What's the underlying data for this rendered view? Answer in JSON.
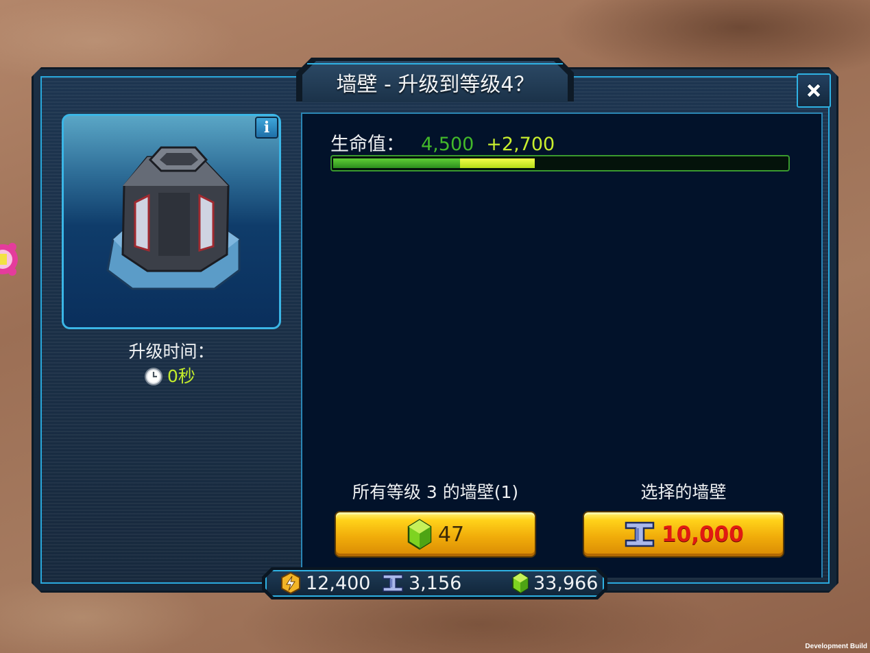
{
  "dialog": {
    "title": "墙壁 - 升级到等级4？",
    "close_icon": "close-icon",
    "info_icon": "info-icon",
    "info_label": "i"
  },
  "building": {
    "icon": "wall-building-icon",
    "upgrade_time_label": "升级时间：",
    "upgrade_time_value": "0秒",
    "clock_icon": "clock-icon"
  },
  "stats": {
    "hp_label": "生命值：",
    "hp_current": "4,500",
    "hp_increase": "+2,700",
    "hp_bar": {
      "current_fraction": 0.28,
      "added_fraction": 0.165,
      "current_color": "#43b92a",
      "added_color": "#c9ee2e"
    }
  },
  "options": {
    "all_label": "所有等级 3 的墙壁(1)",
    "all_cost": "47",
    "all_cost_icon": "gem-icon",
    "selected_label": "选择的墙壁",
    "selected_cost": "10,000",
    "selected_cost_icon": "metal-beam-icon",
    "selected_cost_color": "#e11a12"
  },
  "resources": {
    "energy": "12,400",
    "energy_icon": "energy-coin-icon",
    "metal": "3,156",
    "metal_icon": "metal-beam-icon",
    "gems": "33,966",
    "gems_icon": "gem-icon"
  },
  "footer": {
    "build_text": "Development Build"
  }
}
